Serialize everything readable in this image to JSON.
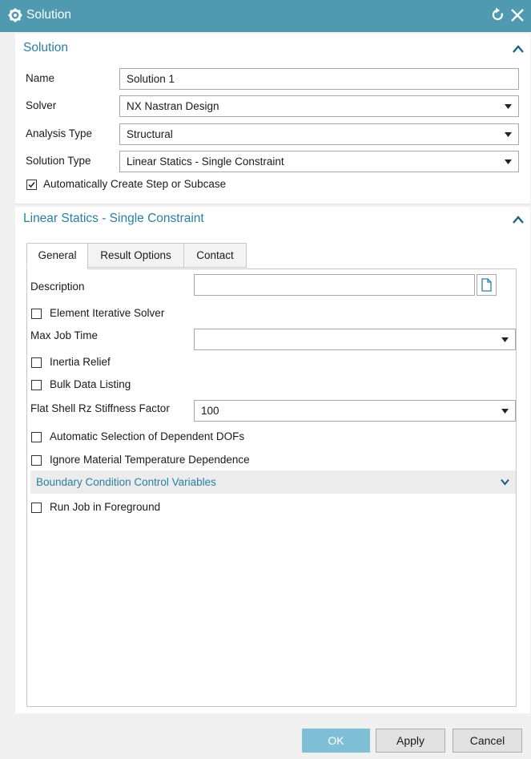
{
  "window": {
    "title": "Solution"
  },
  "solution_section": {
    "header": "Solution",
    "name_label": "Name",
    "name_value": "Solution 1",
    "solver_label": "Solver",
    "solver_value": "NX Nastran Design",
    "analysis_type_label": "Analysis Type",
    "analysis_type_value": "Structural",
    "solution_type_label": "Solution Type",
    "solution_type_value": "Linear Statics - Single Constraint",
    "auto_create_label": "Automatically Create Step or Subcase",
    "auto_create_checked": true
  },
  "linear_section": {
    "header": "Linear Statics - Single Constraint",
    "tabs": [
      "General",
      "Result Options",
      "Contact"
    ],
    "active_tab": "General",
    "description_label": "Description",
    "description_value": "",
    "element_iterative_label": "Element Iterative Solver",
    "max_job_time_label": "Max Job Time",
    "max_job_time_value": "",
    "inertia_relief_label": "Inertia Relief",
    "bulk_data_label": "Bulk Data Listing",
    "flat_shell_label": "Flat Shell Rz Stiffness Factor",
    "flat_shell_value": "100",
    "auto_dof_label": "Automatic Selection of Dependent DOFs",
    "ignore_temp_label": "Ignore Material Temperature Dependence",
    "bcc_label": "Boundary Condition Control Variables",
    "run_job_label": "Run Job in Foreground"
  },
  "buttons": {
    "ok": "OK",
    "apply": "Apply",
    "cancel": "Cancel"
  },
  "colors": {
    "titlebar": "#4f9ab1",
    "accent_text": "#2a7fa3",
    "ok_button": "#7fbfd6"
  },
  "icons": [
    "gear-icon",
    "reset-icon",
    "close-icon",
    "collapse-icon",
    "dropdown-arrow-icon",
    "file-icon",
    "expand-icon"
  ]
}
